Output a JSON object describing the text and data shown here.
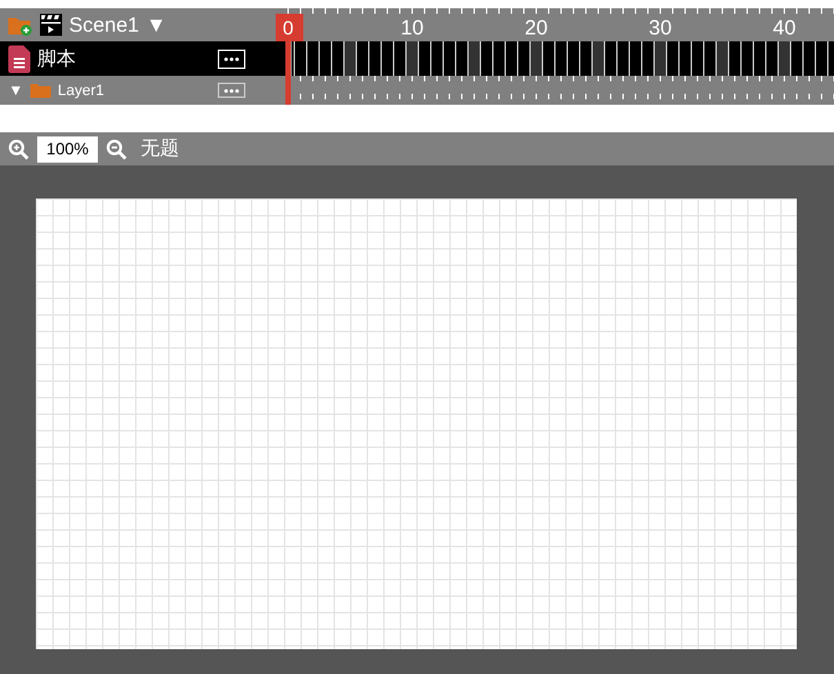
{
  "timeline": {
    "scene": {
      "name": "Scene1",
      "caret": "▼"
    },
    "playhead": {
      "label": "0"
    },
    "ruler": {
      "labels": [
        "10",
        "20",
        "30",
        "40"
      ]
    },
    "layers": [
      {
        "kind": "script",
        "name": "脚本"
      },
      {
        "kind": "layer",
        "name": "Layer1",
        "toggle": "▼"
      }
    ]
  },
  "stage": {
    "zoom": "100%",
    "title": "无题"
  }
}
